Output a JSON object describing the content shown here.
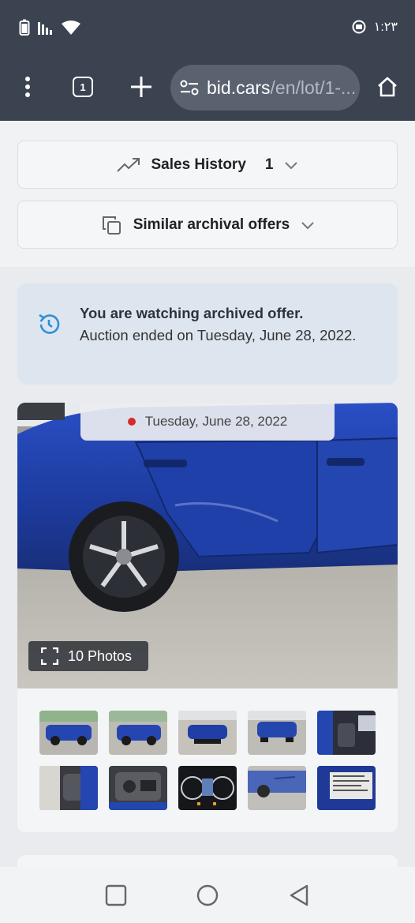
{
  "status_bar": {
    "time": "١:٢٣"
  },
  "browser": {
    "tab_count": "1",
    "url_host": "bid.cars",
    "url_path": "/en/lot/1-..."
  },
  "accordions": {
    "sales_history": {
      "label": "Sales History",
      "count": "1"
    },
    "similar": {
      "label": "Similar archival offers"
    }
  },
  "alert": {
    "title": "You are watching archived offer.",
    "body": "Auction ended on Tuesday, June 28, 2022."
  },
  "gallery": {
    "date": "Tuesday, June 28, 2022",
    "photos_label": "10 Photos",
    "thumbnails": [
      "car-rear-left",
      "car-front-left",
      "car-front",
      "car-rear",
      "interior-front",
      "interior-rear",
      "engine-bay",
      "dashboard-gauges",
      "side-damage",
      "window-sticker"
    ]
  },
  "colors": {
    "browser_bar": "#3b4350",
    "alert_bg": "#dde6ef",
    "car_blue": "#1e3fa0",
    "status_dot": "#d42b2b"
  }
}
